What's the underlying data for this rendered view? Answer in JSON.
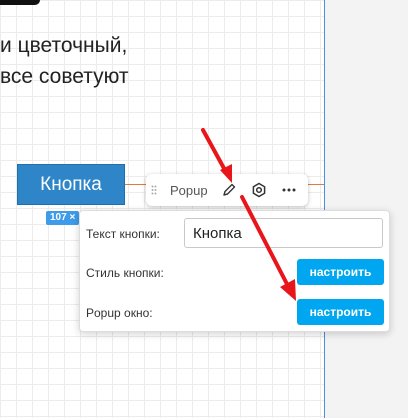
{
  "canvas": {
    "text_lines": [
      "и цветочный,",
      "все советуют"
    ],
    "button_label": "Кнопка",
    "size_badge": "107 ×"
  },
  "toolbar": {
    "label": "Popup",
    "icons": [
      "drag-handle-icon",
      "pencil-icon",
      "gear-icon",
      "more-icon"
    ]
  },
  "settings": {
    "text_label": "Текст кнопки:",
    "text_value": "Кнопка",
    "style_label": "Стиль кнопки:",
    "style_button": "настроить",
    "popup_label": "Popup окно:",
    "popup_button": "настроить"
  },
  "colors": {
    "accent": "#00a7f0",
    "button_bg": "#2e86c9",
    "arrow": "#e8151b"
  }
}
